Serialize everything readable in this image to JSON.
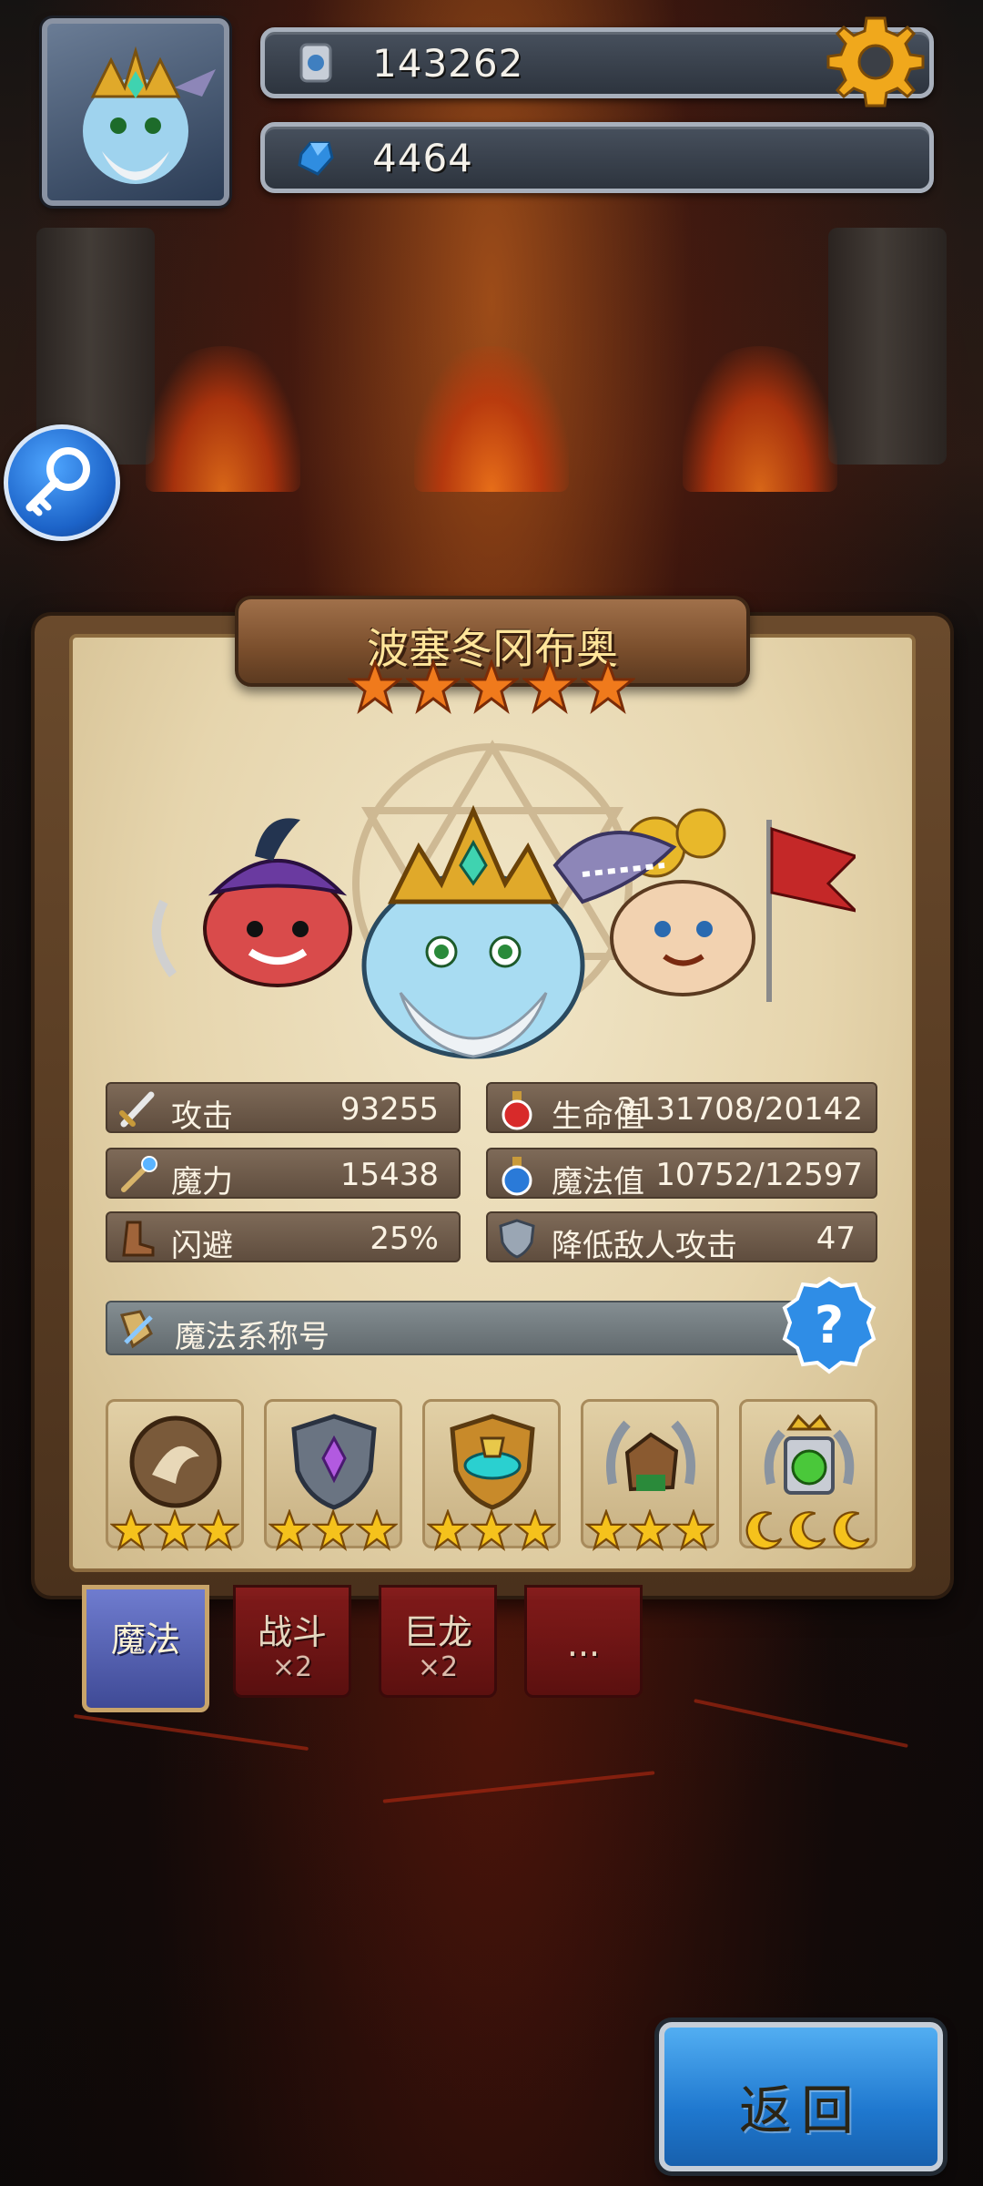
{
  "hud": {
    "coins": "143262",
    "gems": "4464"
  },
  "hero": {
    "name": "波塞冬冈布奥",
    "star_count": 5
  },
  "stats": {
    "attack_label": "攻击",
    "attack_value": "93255",
    "hp_label": "生命值",
    "hp_value": "3131708/20142",
    "magic_label": "魔力",
    "magic_value": "15438",
    "mana_label": "魔法值",
    "mana_value": "10752/12597",
    "dodge_label": "闪避",
    "dodge_value": "25%",
    "reduce_label": "降低敌人攻击",
    "reduce_value": "47"
  },
  "title_bar": {
    "label": "魔法系称号"
  },
  "badges": [
    {
      "emblem": "shield-dragon-emblem",
      "stars": 3
    },
    {
      "emblem": "shield-crystal-emblem",
      "stars": 3
    },
    {
      "emblem": "shield-chalice-emblem",
      "stars": 3
    },
    {
      "emblem": "laurel-rock-emblem",
      "stars": 3
    },
    {
      "emblem": "crown-portal-emblem",
      "moons": 3
    }
  ],
  "tabs": [
    {
      "label": "魔法",
      "count": "",
      "active": true
    },
    {
      "label": "战斗",
      "count": "×2",
      "active": false
    },
    {
      "label": "巨龙",
      "count": "×2",
      "active": false
    },
    {
      "label": "...",
      "count": "",
      "active": false
    }
  ],
  "return_button": {
    "label": "返回"
  },
  "colors": {
    "accent_gold": "#ffe59a",
    "button_blue": "#1f78cf",
    "tab_active": "#3f4a96",
    "tab_inactive": "#8a1c1c"
  }
}
